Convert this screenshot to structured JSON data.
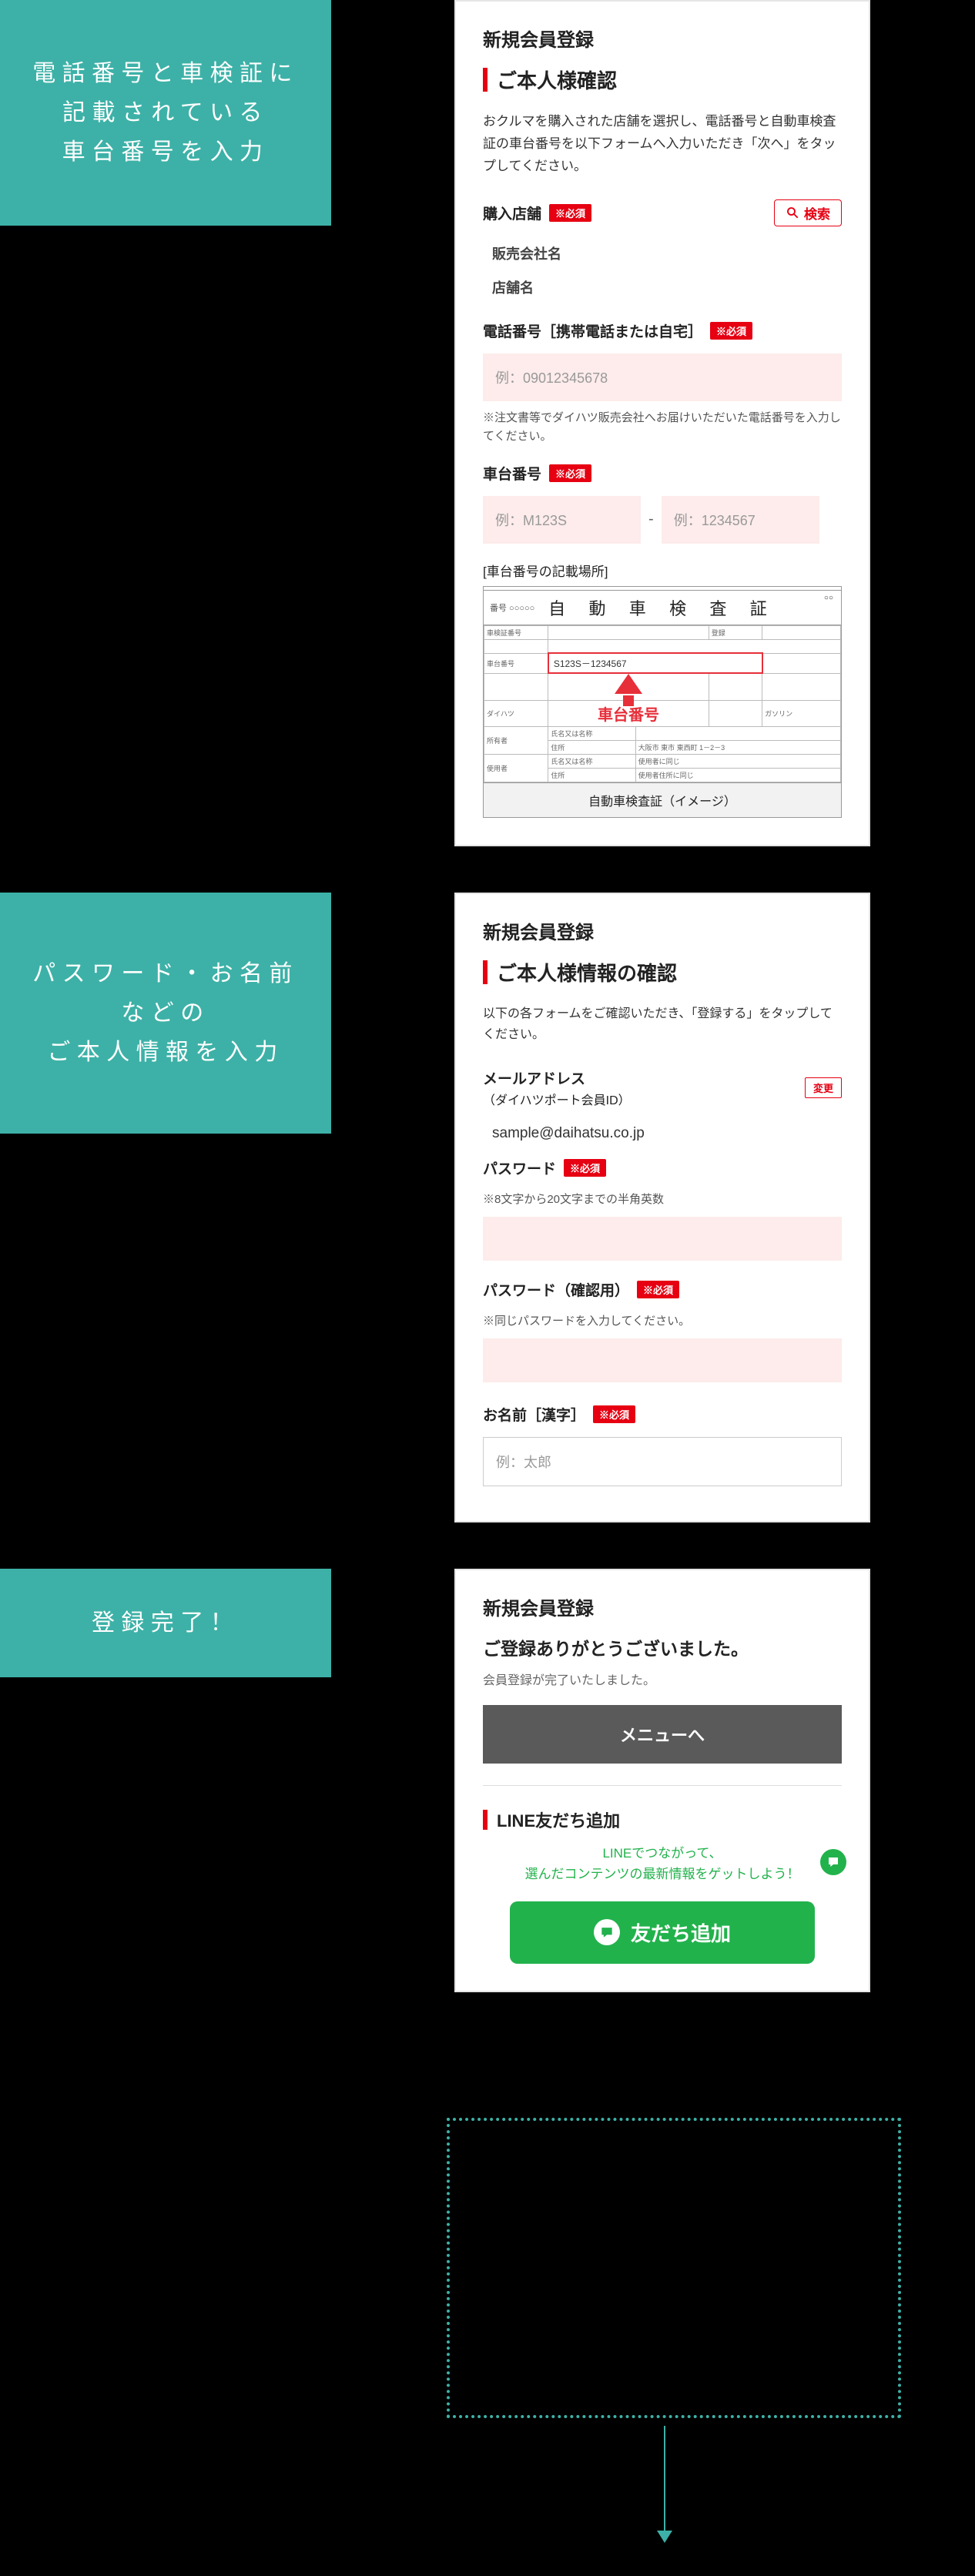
{
  "step1": {
    "label_l1": "電話番号と車検証に",
    "label_l2": "記載されている",
    "label_l3": "車台番号を入力",
    "title": "新規会員登録",
    "heading": "ご本人様確認",
    "desc": "おクルマを購入された店舗を選択し、電話番号と自動車検査証の車台番号を以下フォームへ入力いただき「次へ」をタップしてください。",
    "store_label": "購入店舗",
    "required": "※必須",
    "search": "検索",
    "company": "販売会社名",
    "shop": "店舗名",
    "phone_label": "電話番号［携帯電話または自宅］",
    "phone_placeholder": "例：09012345678",
    "phone_note": "※注文書等でダイハツ販売会社へお届けいただいた電話番号を入力してください。",
    "chassis_label": "車台番号",
    "chassis_ph1": "例：M123S",
    "chassis_ph2": "例：1234567",
    "cert_caption": "[車台番号の記載場所]",
    "cert_num": "番号 ○○○○○",
    "cert_title": "自 動 車 検 査 証",
    "cert_yy": "○○",
    "cert_sample": "S123S－1234567",
    "cert_brand": "ダイハツ",
    "cert_row_a": "所有者",
    "cert_row_b": "使用者",
    "cert_name": "氏名又は名称",
    "cert_addr": "住所",
    "cert_addr_v": "大阪市 東市 東西町 1－2－3",
    "cert_name2": "氏名又は名称",
    "cert_use": "使用者に同じ",
    "cert_addr2": "住所",
    "cert_use2": "使用者住所に同じ",
    "cert_arrow_label": "車台番号",
    "cert_footer": "自動車検査証（イメージ）",
    "cert_gas": "ガソリン"
  },
  "step2": {
    "label_l1": "パスワード・お名前",
    "label_l2": "などの",
    "label_l3": "ご本人情報を入力",
    "title": "新規会員登録",
    "heading": "ご本人様情報の確認",
    "desc": "以下の各フォームをご確認いただき、「登録する」をタップしてください。",
    "email_label": "メールアドレス",
    "email_sub": "（ダイハツポート会員ID）",
    "edit": "変更",
    "email_value": "sample@daihatsu.co.jp",
    "pw_label": "パスワード",
    "required": "※必須",
    "pw_note": "※8文字から20文字までの半角英数",
    "pw2_label": "パスワード（確認用）",
    "pw2_note": "※同じパスワードを入力してください。",
    "name_label": "お名前［漢字］",
    "name_ph": "例：太郎"
  },
  "step3": {
    "label": "登録完了！",
    "title": "新規会員登録",
    "heading": "ご登録ありがとうございました。",
    "sub": "会員登録が完了いたしました。",
    "menu": "メニューへ",
    "line_heading": "LINE友だち追加",
    "line_text_l1": "LINEでつながって、",
    "line_text_l2": "選んだコンテンツの最新情報をゲットしよう！",
    "line_btn": "友だち追加"
  }
}
